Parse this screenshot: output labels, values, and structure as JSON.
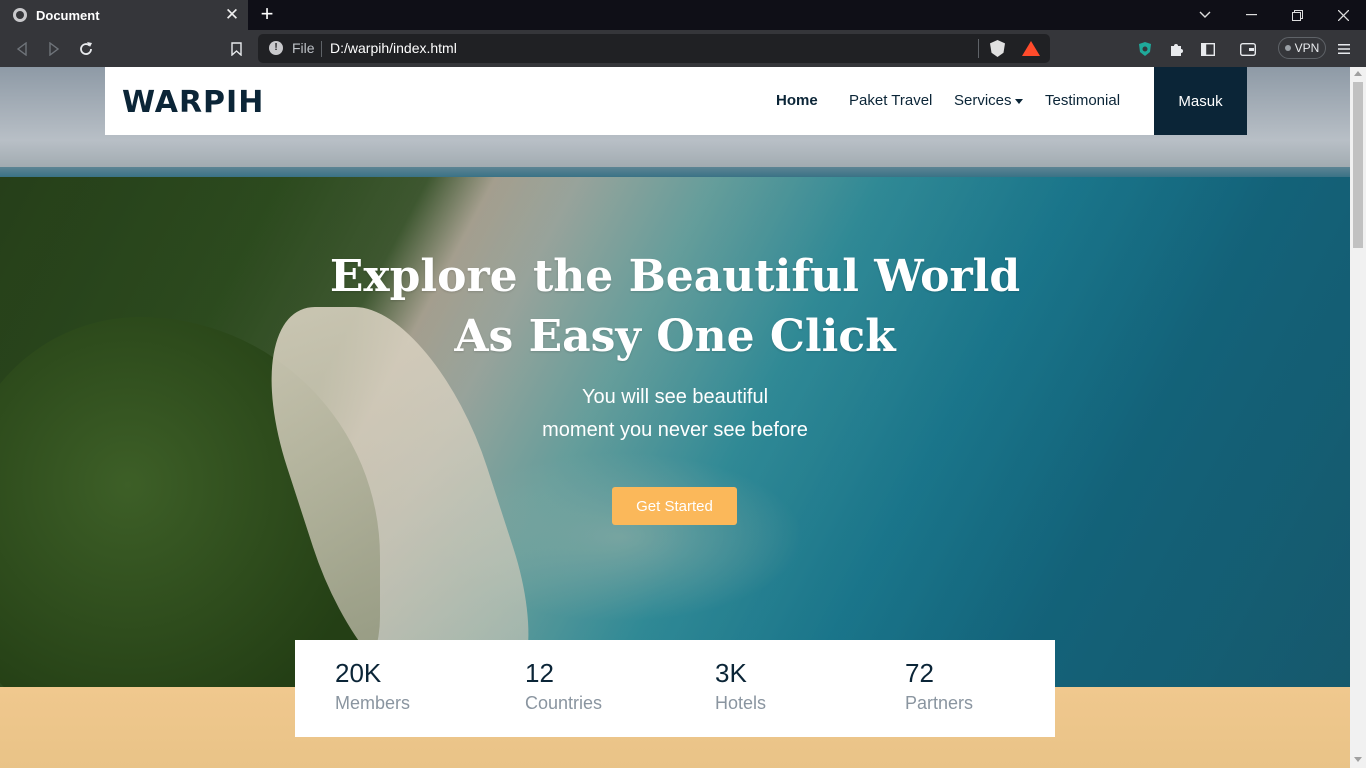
{
  "browser": {
    "tab_title": "Document",
    "tab_close": "✕",
    "new_tab": "+",
    "address_scheme": "File",
    "address_url": "D:/warpih/index.html",
    "vpn_label": "VPN",
    "colors": {
      "tabbar": "#0f0f17",
      "toolbar": "#35363a",
      "omnibox": "#202124"
    }
  },
  "site": {
    "logo": "WARPIH",
    "nav": {
      "home": "Home",
      "paket": "Paket Travel",
      "services": "Services",
      "testimonial": "Testimonial",
      "login": "Masuk"
    },
    "hero": {
      "title_line1": "Explore the Beautiful World",
      "title_line2": "As Easy One Click",
      "subtitle_line1": "You will see beautiful",
      "subtitle_line2": "moment you never see before",
      "cta": "Get Started"
    },
    "stats": [
      {
        "value": "20K",
        "label": "Members"
      },
      {
        "value": "12",
        "label": "Countries"
      },
      {
        "value": "3K",
        "label": "Hotels"
      },
      {
        "value": "72",
        "label": "Partners"
      }
    ],
    "colors": {
      "primary": "#0b2537",
      "accent": "#fbb85a",
      "band": "#f0c88e"
    }
  }
}
